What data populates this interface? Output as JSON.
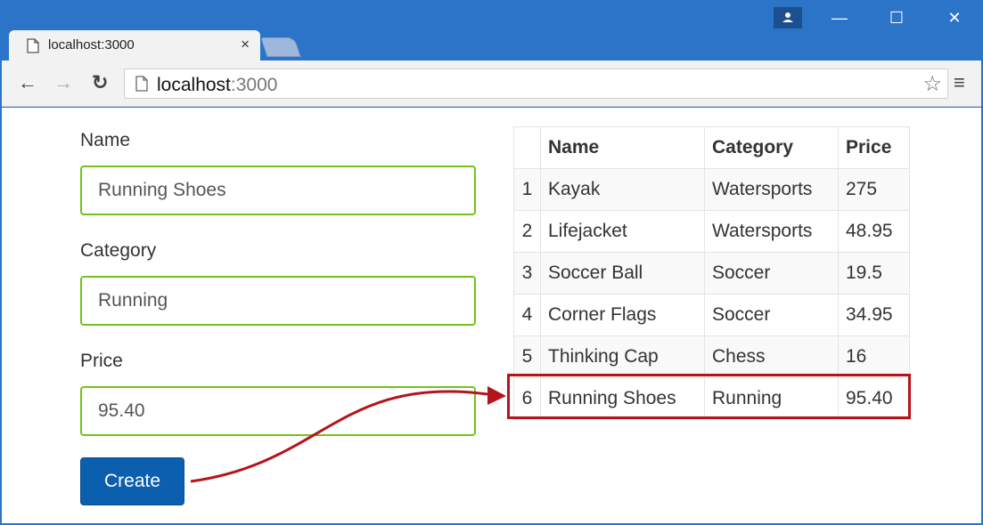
{
  "browser": {
    "tab_title": "localhost:3000",
    "tab_close": "×",
    "url_host": "localhost",
    "url_port": ":3000",
    "icons": {
      "back": "←",
      "forward": "→",
      "reload": "↻",
      "star": "☆",
      "menu": "≡",
      "minimize": "—",
      "maximize": "☐",
      "close": "✕"
    }
  },
  "form": {
    "name_label": "Name",
    "name_value": "Running Shoes",
    "category_label": "Category",
    "category_value": "Running",
    "price_label": "Price",
    "price_value": "95.40",
    "create_label": "Create"
  },
  "table": {
    "headers": [
      "",
      "Name",
      "Category",
      "Price"
    ],
    "rows": [
      [
        "1",
        "Kayak",
        "Watersports",
        "275"
      ],
      [
        "2",
        "Lifejacket",
        "Watersports",
        "48.95"
      ],
      [
        "3",
        "Soccer Ball",
        "Soccer",
        "19.5"
      ],
      [
        "4",
        "Corner Flags",
        "Soccer",
        "34.95"
      ],
      [
        "5",
        "Thinking Cap",
        "Chess",
        "16"
      ],
      [
        "6",
        "Running Shoes",
        "Running",
        "95.40"
      ]
    ]
  },
  "colors": {
    "chrome_blue": "#2b74c8",
    "input_border_valid": "#71c31a",
    "button_primary": "#0c5eae",
    "highlight": "#b4141b"
  }
}
